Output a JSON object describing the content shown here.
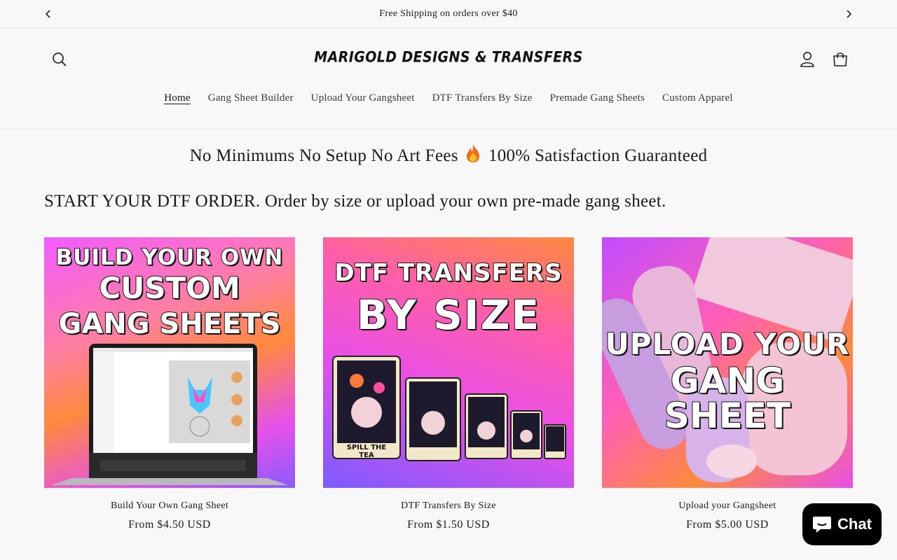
{
  "announcement": {
    "text": "Free Shipping on orders over $40",
    "prev_icon": "chevron-left-icon",
    "next_icon": "chevron-right-icon"
  },
  "header": {
    "logo": "MARIGOLD DESIGNS & TRANSFERS",
    "icons": [
      "search-icon",
      "account-icon",
      "cart-icon"
    ]
  },
  "nav": {
    "items": [
      {
        "label": "Home",
        "active": true
      },
      {
        "label": "Gang Sheet Builder"
      },
      {
        "label": "Upload Your Gangsheet"
      },
      {
        "label": "DTF Transfers By Size"
      },
      {
        "label": "Premade Gang Sheets"
      },
      {
        "label": "Custom Apparel"
      }
    ]
  },
  "banner": {
    "left": "No Minimums No Setup No Art Fees",
    "icon": "fire-emoji-icon",
    "right": "100% Satisfaction Guaranteed"
  },
  "section": {
    "title": "START YOUR DTF ORDER. Order by size or upload your own pre-made gang sheet."
  },
  "products": [
    {
      "title": "Build Your Own Gang Sheet",
      "price": "From $4.50 USD",
      "image_text": [
        "BUILD YOUR OWN",
        "CUSTOM",
        "GANG SHEETS"
      ]
    },
    {
      "title": "DTF Transfers By Size",
      "price": "From $1.50 USD",
      "image_text": [
        "DTF TRANSFERS",
        "BY SIZE"
      ],
      "card_caption": "SPILL THE TEA"
    },
    {
      "title": "Upload your Gangsheet",
      "price": "From $5.00 USD",
      "image_text": [
        "UPLOAD YOUR",
        "GANG SHEET"
      ]
    }
  ],
  "chat": {
    "label": "Chat",
    "icon": "chat-bubble-icon"
  },
  "colors": {
    "background": "#f8f8f8",
    "text": "#1a1a1a",
    "chat_bg": "#000000",
    "accent_pink": "#f25bff",
    "accent_orange": "#ff8a3d",
    "accent_purple": "#7c5bff"
  }
}
